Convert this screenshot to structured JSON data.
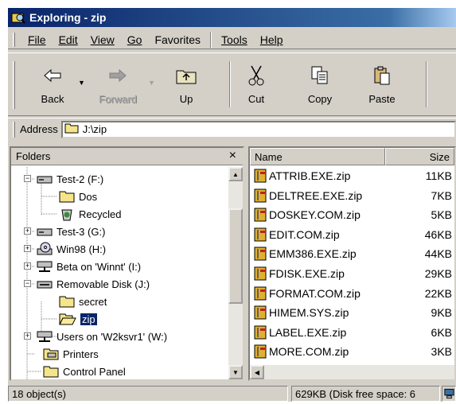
{
  "window": {
    "title": "Exploring - zip"
  },
  "menu": [
    "File",
    "Edit",
    "View",
    "Go",
    "Favorites",
    "Tools",
    "Help"
  ],
  "toolbar": {
    "back": "Back",
    "forward": "Forward",
    "up": "Up",
    "cut": "Cut",
    "copy": "Copy",
    "paste": "Paste"
  },
  "address": {
    "label": "Address",
    "value": "J:\\zip"
  },
  "folders": {
    "header": "Folders",
    "close": "×",
    "items": [
      {
        "label": "Test-2 (F:)",
        "icon": "drive-icon",
        "expander": "−"
      },
      {
        "label": "Dos",
        "icon": "folder-icon",
        "expander": ""
      },
      {
        "label": "Recycled",
        "icon": "recycle-bin-icon",
        "expander": ""
      },
      {
        "label": "Test-3 (G:)",
        "icon": "drive-icon",
        "expander": "+"
      },
      {
        "label": "Win98 (H:)",
        "icon": "cd-drive-icon",
        "expander": "+"
      },
      {
        "label": "Beta on 'Winnt' (I:)",
        "icon": "network-drive-icon",
        "expander": "+"
      },
      {
        "label": "Removable Disk (J:)",
        "icon": "removable-disk-icon",
        "expander": "−"
      },
      {
        "label": "secret",
        "icon": "folder-icon",
        "expander": ""
      },
      {
        "label": "zip",
        "icon": "open-folder-icon",
        "expander": ""
      },
      {
        "label": "Users on 'W2ksvr1' (W:)",
        "icon": "network-drive-icon",
        "expander": "+"
      },
      {
        "label": "Printers",
        "icon": "printer-folder-icon",
        "expander": ""
      },
      {
        "label": "Control Panel",
        "icon": "control-panel-icon",
        "expander": ""
      }
    ]
  },
  "files": {
    "columns": {
      "name": "Name",
      "size": "Size"
    },
    "rows": [
      {
        "name": "ATTRIB.EXE.zip",
        "size": "11KB"
      },
      {
        "name": "DELTREE.EXE.zip",
        "size": "7KB"
      },
      {
        "name": "DOSKEY.COM.zip",
        "size": "5KB"
      },
      {
        "name": "EDIT.COM.zip",
        "size": "46KB"
      },
      {
        "name": "EMM386.EXE.zip",
        "size": "44KB"
      },
      {
        "name": "FDISK.EXE.zip",
        "size": "29KB"
      },
      {
        "name": "FORMAT.COM.zip",
        "size": "22KB"
      },
      {
        "name": "HIMEM.SYS.zip",
        "size": "9KB"
      },
      {
        "name": "LABEL.EXE.zip",
        "size": "6KB"
      },
      {
        "name": "MORE.COM.zip",
        "size": "3KB"
      }
    ]
  },
  "status": {
    "objects": "18 object(s)",
    "space": "629KB (Disk free space: 6"
  }
}
